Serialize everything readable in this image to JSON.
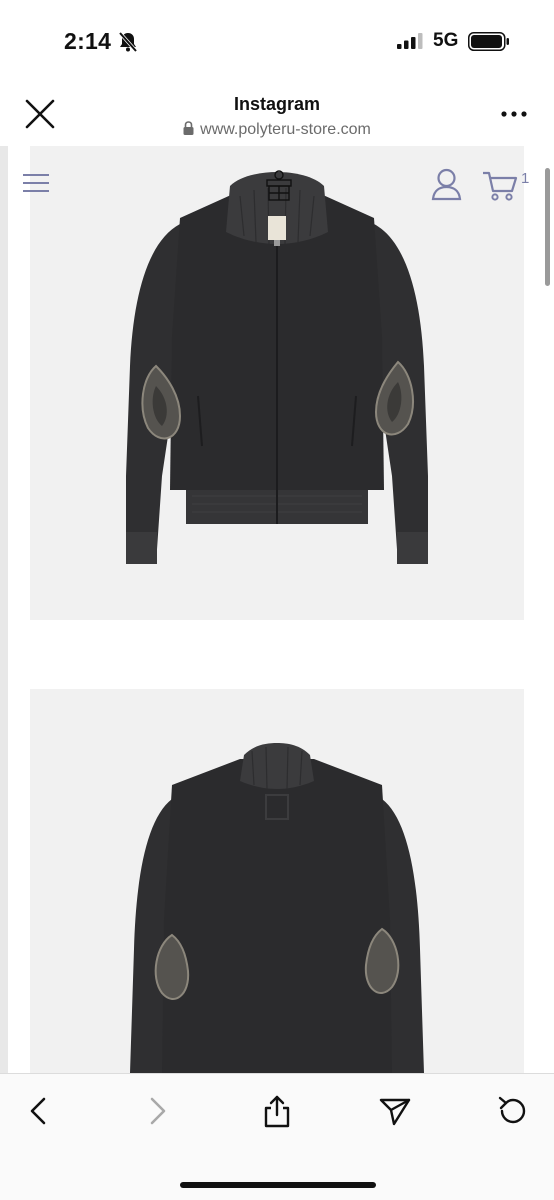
{
  "status_bar": {
    "time": "2:14",
    "network": "5G"
  },
  "browser": {
    "title": "Instagram",
    "url": "www.polyteru-store.com"
  },
  "site": {
    "cart_count": "1"
  },
  "colors": {
    "site_icon": "#7b7fa8",
    "photo_background": "#f1f1f1",
    "garment": "#2b2b2d"
  },
  "icons": [
    "bell-slash-icon",
    "signal-icon",
    "battery-icon",
    "close-icon",
    "lock-icon",
    "more-icon",
    "menu-icon",
    "account-icon",
    "cart-icon",
    "back-icon",
    "forward-icon",
    "share-icon",
    "send-icon",
    "reload-icon"
  ]
}
